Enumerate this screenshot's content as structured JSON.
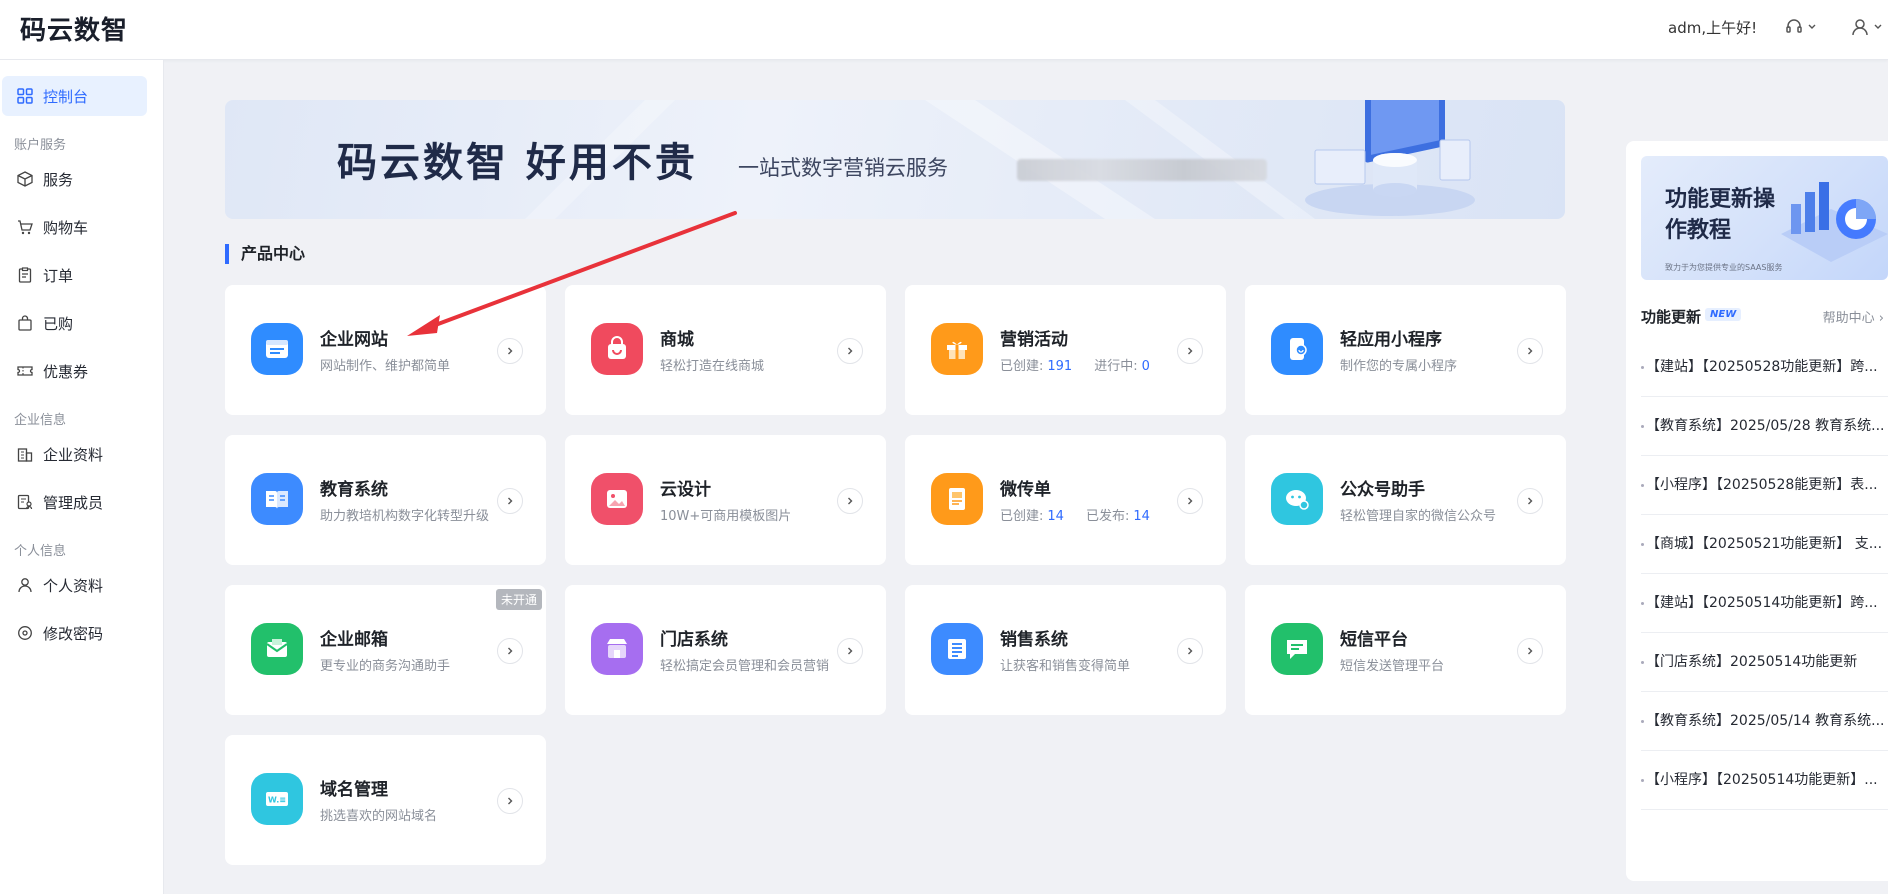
{
  "header": {
    "logo": "码云数智",
    "greeting": "adm,上午好!",
    "icons": [
      "headset-icon",
      "user-icon"
    ]
  },
  "sidebar": {
    "items": [
      {
        "label": "控制台",
        "icon": "dashboard-icon",
        "active": true
      },
      {
        "group": "账户服务"
      },
      {
        "label": "服务",
        "icon": "box-icon"
      },
      {
        "label": "购物车",
        "icon": "cart-icon"
      },
      {
        "label": "订单",
        "icon": "order-icon"
      },
      {
        "label": "已购",
        "icon": "bag-icon"
      },
      {
        "label": "优惠券",
        "icon": "coupon-icon"
      },
      {
        "group": "企业信息"
      },
      {
        "label": "企业资料",
        "icon": "building-icon"
      },
      {
        "label": "管理成员",
        "icon": "members-icon"
      },
      {
        "group": "个人信息"
      },
      {
        "label": "个人资料",
        "icon": "person-icon"
      },
      {
        "label": "修改密码",
        "icon": "lock-icon"
      }
    ]
  },
  "banner": {
    "title": "码云数智  好用不贵",
    "subtitle": "一站式数字营销云服务"
  },
  "section_title": "产品中心",
  "cards": [
    {
      "title": "企业网站",
      "desc": "网站制作、维护都简单",
      "color": "#2f8cff",
      "icon": "website-icon"
    },
    {
      "title": "商城",
      "desc": "轻松打造在线商城",
      "color": "#f04a5e",
      "icon": "shopping-bag-icon"
    },
    {
      "title": "营销活动",
      "desc_label_1": "已创建:",
      "num_1": "191",
      "desc_label_2": "进行中:",
      "num_2": "0",
      "color": "#ff9a1a",
      "icon": "gift-icon"
    },
    {
      "title": "轻应用小程序",
      "desc": "制作您的专属小程序",
      "color": "#2f8cff",
      "icon": "mini-program-icon"
    },
    {
      "title": "教育系统",
      "desc": "助力教培机构数字化转型升级",
      "color": "#3d8bff",
      "icon": "book-icon"
    },
    {
      "title": "云设计",
      "desc": "10W+可商用模板图片",
      "color": "#f0506a",
      "icon": "image-icon"
    },
    {
      "title": "微传单",
      "desc_label_1": "已创建:",
      "num_1": "14",
      "desc_label_2": "已发布:",
      "num_2": "14",
      "color": "#ff9a1a",
      "icon": "flyer-icon"
    },
    {
      "title": "公众号助手",
      "desc": "轻松管理自家的微信公众号",
      "color": "#2fc6e0",
      "icon": "wechat-icon"
    },
    {
      "title": "企业邮箱",
      "desc": "更专业的商务沟通助手",
      "color": "#22c06b",
      "icon": "mail-icon",
      "badge": "未开通"
    },
    {
      "title": "门店系统",
      "desc": "轻松搞定会员管理和会员营销",
      "color": "#a66ef0",
      "icon": "store-icon"
    },
    {
      "title": "销售系统",
      "desc": "让获客和销售变得简单",
      "color": "#3d8bff",
      "icon": "list-icon"
    },
    {
      "title": "短信平台",
      "desc": "短信发送管理平台",
      "color": "#22c06b",
      "icon": "message-icon"
    },
    {
      "title": "域名管理",
      "desc": "挑选喜欢的网站域名",
      "color": "#2fc6e0",
      "icon": "domain-icon"
    }
  ],
  "right_panel": {
    "banner_title": "功能更新操作教程",
    "banner_sub": "致力于为您提供专业的SAAS服务",
    "head_title": "功能更新",
    "head_badge": "NEW",
    "help_link": "帮助中心 ›",
    "news": [
      "【建站】【20250528功能更新】跨...",
      "【教育系统】2025/05/28 教育系统...",
      "【小程序】【20250528能更新】表...",
      "【商城】【20250521功能更新】 支...",
      "【建站】【20250514功能更新】跨...",
      "【门店系统】20250514功能更新",
      "【教育系统】2025/05/14 教育系统...",
      "【小程序】【20250514功能更新】..."
    ]
  }
}
